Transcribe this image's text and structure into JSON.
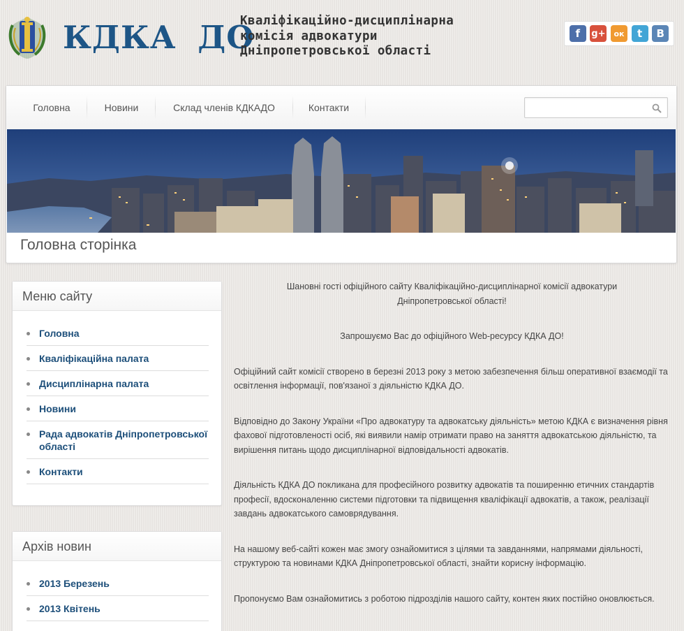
{
  "header": {
    "logo_text": "КДКА ДО",
    "commission_lines": [
      "Кваліфікаційно-дисциплінарна",
      "комісія адвокатури",
      "Дніпропетровської області"
    ]
  },
  "social": [
    {
      "icon": "facebook-icon",
      "glyph": "f",
      "color": "#4d6fa9"
    },
    {
      "icon": "google-plus-icon",
      "glyph": "g+",
      "color": "#d8513c"
    },
    {
      "icon": "odnoklassniki-icon",
      "glyph": "ок",
      "color": "#f09a31"
    },
    {
      "icon": "twitter-icon",
      "glyph": "t",
      "color": "#42a5d6"
    },
    {
      "icon": "vkontakte-icon",
      "glyph": "B",
      "color": "#5b86b6"
    }
  ],
  "nav": {
    "items": [
      "Головна",
      "Новини",
      "Склад членів КДКАДО",
      "Контакти"
    ],
    "search_placeholder": ""
  },
  "page_title": "Головна сторінка",
  "site_menu": {
    "title": "Меню сайту",
    "items": [
      "Головна",
      "Кваліфікаційна палата",
      "Дисциплінарна палата",
      "Новини",
      "Рада адвокатів Дніпропетровської області",
      "Контакти"
    ]
  },
  "archive": {
    "title": "Архів новин",
    "items": [
      "2013 Березень",
      "2013 Квітень"
    ]
  },
  "content": {
    "greeting": "Шановні гості офіційного сайту Кваліфікаційно-дисциплінарної комісії адвокатури Дніпропетровської області!",
    "invite": "Запрошуємо Вас до офіційного Web-ресурсу КДКА ДО!",
    "paragraphs": [
      "Офіційний сайт комісії створено в березні 2013 року з метою забезпечення більш оперативної взаємодії та освітлення інформації, пов'язаної з діяльністю КДКА ДО.",
      "Відповідно до Закону України «Про адвокатуру та адвокатську діяльність» метою КДКА є визначення рівня фахової підготовленості осіб, які виявили намір отримати право на заняття адвокатською діяльністю, та вирішення питань щодо дисциплінарної відповідальності адвокатів.",
      "Діяльність КДКА ДО покликана для професійного розвитку адвокатів та поширенню етичних стандартів професії, вдосконаленню системи підготовки та підвищення кваліфікації адвокатів, а також, реалізації завдань адвокатського самоврядування.",
      "На нашому веб-сайті кожен має змогу ознайомитися з цілями та завданнями, напрямами діяльності, структурою та новинами КДКА Дніпропетровської області, знайти корисну інформацію.",
      "Пропонуємо Вам ознайомитись з роботою підрозділів нашого сайту, контен яких постійно оновлюється."
    ]
  }
}
